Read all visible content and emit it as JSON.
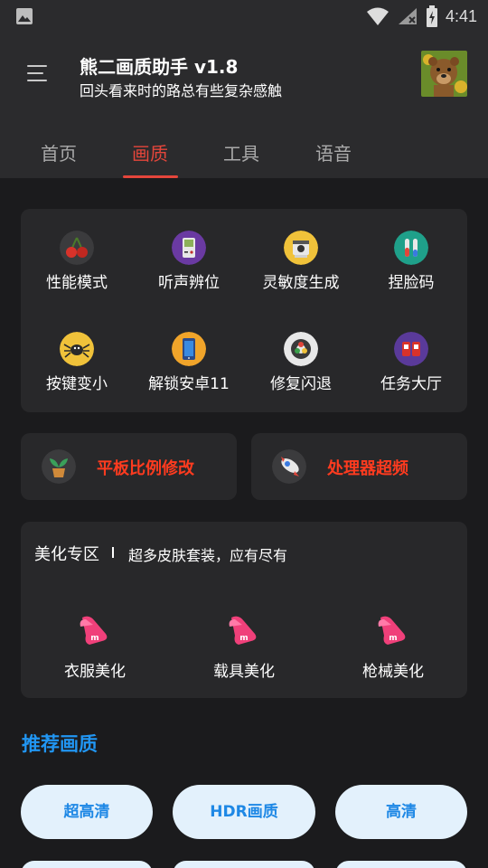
{
  "status_bar": {
    "time": "4:41"
  },
  "header": {
    "title": "熊二画质助手 v1.8",
    "subtitle": "回头看来时的路总有些复杂感触"
  },
  "tabs": [
    {
      "label": "首页"
    },
    {
      "label": "画质"
    },
    {
      "label": "工具"
    },
    {
      "label": "语音"
    }
  ],
  "grid": [
    {
      "label": "性能模式",
      "icon": "cherry-icon"
    },
    {
      "label": "听声辨位",
      "icon": "gameboy-icon"
    },
    {
      "label": "灵敏度生成",
      "icon": "camera-icon"
    },
    {
      "label": "捏脸码",
      "icon": "test-tubes-icon"
    },
    {
      "label": "按键变小",
      "icon": "spider-icon"
    },
    {
      "label": "解锁安卓11",
      "icon": "phone-icon"
    },
    {
      "label": "修复闪退",
      "icon": "chrome-icon"
    },
    {
      "label": "任务大厅",
      "icon": "gamepad-icon"
    }
  ],
  "features": [
    {
      "label": "平板比例修改",
      "icon": "plant-pot-icon"
    },
    {
      "label": "处理器超频",
      "icon": "rocket-icon"
    }
  ],
  "beauty": {
    "title": "美化专区",
    "description": "超多皮肤套装，应有尽有",
    "items": [
      {
        "label": "衣服美化"
      },
      {
        "label": "载具美化"
      },
      {
        "label": "枪械美化"
      }
    ]
  },
  "recommend": {
    "title": "推荐画质",
    "pills": [
      {
        "label": "超高清"
      },
      {
        "label": "HDR画质"
      },
      {
        "label": "高清"
      }
    ]
  },
  "colors": {
    "accent": "#e5463b",
    "feature_text": "#ff3b1f",
    "recommend_blue": "#2196f3",
    "background": "#1b1b1d",
    "card": "#28282a"
  }
}
